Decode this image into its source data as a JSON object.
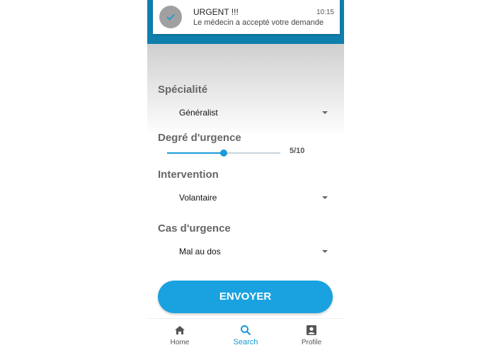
{
  "notification": {
    "title": "URGENT !!!",
    "time": "10:15",
    "message": "Le médecin a accepté votre demande"
  },
  "form": {
    "specialite": {
      "label": "Spécialité",
      "value": "Généralist"
    },
    "urgence": {
      "label": "Degré d'urgence",
      "value": 5,
      "max": 10,
      "display": "5/10"
    },
    "intervention": {
      "label": "Intervention",
      "value": "Volantaire"
    },
    "cas": {
      "label": "Cas d'urgence",
      "value": "Mal au dos"
    },
    "submit_label": "ENVOYER"
  },
  "bottom_nav": {
    "items": [
      {
        "label": "Home",
        "icon": "home-icon"
      },
      {
        "label": "Search",
        "icon": "search-icon",
        "active": true
      },
      {
        "label": "Profile",
        "icon": "profile-icon"
      }
    ]
  },
  "colors": {
    "accent": "#1aa2e0",
    "topbar": "#0f7fae",
    "label": "#666666"
  }
}
